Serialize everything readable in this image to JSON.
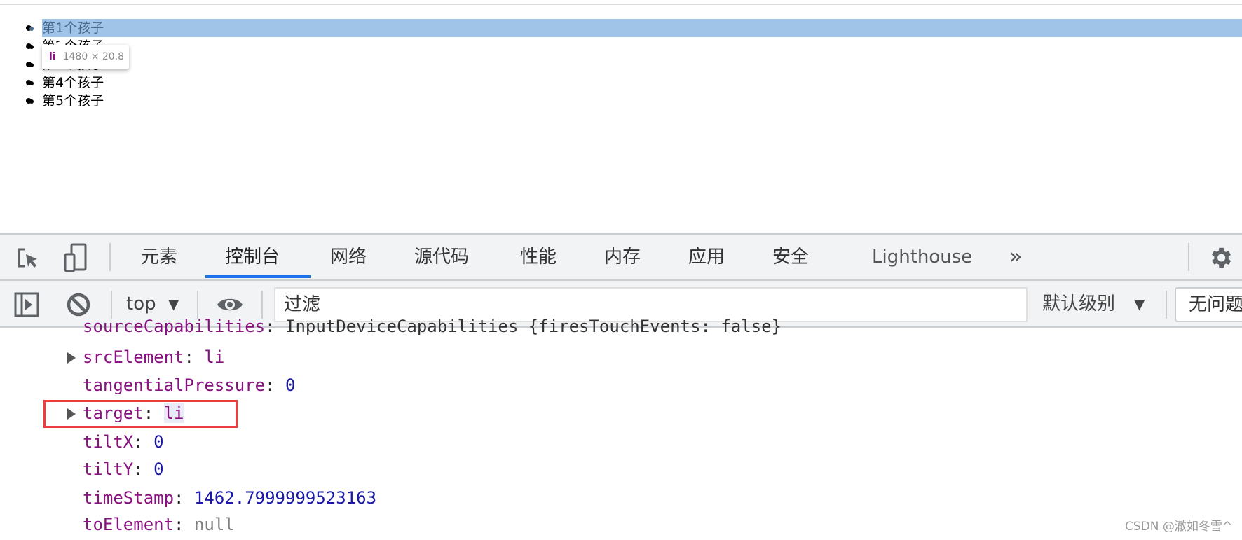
{
  "page": {
    "list_items": [
      "第1个孩子",
      "第2个孩子",
      "第3个孩子",
      "第4个孩子",
      "第5个孩子"
    ],
    "tooltip": {
      "tag": "li",
      "size": "1480 × 20.8"
    }
  },
  "devtools": {
    "tabs": [
      {
        "label": "元素"
      },
      {
        "label": "控制台",
        "active": true
      },
      {
        "label": "网络"
      },
      {
        "label": "源代码"
      },
      {
        "label": "性能"
      },
      {
        "label": "内存"
      },
      {
        "label": "应用"
      },
      {
        "label": "安全"
      },
      {
        "label": "Lighthouse"
      }
    ],
    "more_tabs": "»",
    "toolbar": {
      "context": "top",
      "filter_placeholder": "过滤",
      "level": "默认级别",
      "issues": "无问题"
    },
    "console_rows": [
      {
        "key": "sourceCapabilities",
        "value": "InputDeviceCapabilities {firesTouchEvents: false}",
        "expandable": true
      },
      {
        "key": "srcElement",
        "value": "li",
        "expandable": true
      },
      {
        "key": "tangentialPressure",
        "value": "0",
        "expandable": false
      },
      {
        "key": "target",
        "value": "li",
        "expandable": true,
        "highlighted": true
      },
      {
        "key": "tiltX",
        "value": "0",
        "expandable": false
      },
      {
        "key": "tiltY",
        "value": "0",
        "expandable": false
      },
      {
        "key": "timeStamp",
        "value": "1462.7999999523163",
        "expandable": false
      },
      {
        "key": "toElement",
        "value": "null",
        "expandable": false
      }
    ],
    "colors": {
      "accent": "#1a73e8",
      "key": "#881280",
      "number": "#1a1aa6",
      "highlight_box": "#f03c3c"
    }
  },
  "watermark": "CSDN @澈如冬雪^"
}
